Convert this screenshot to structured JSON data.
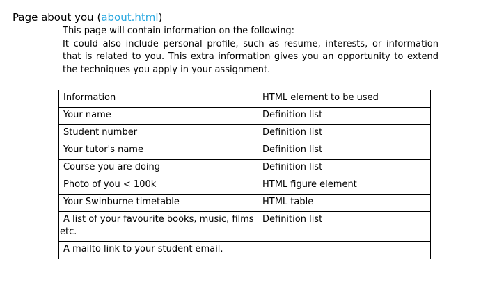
{
  "heading": {
    "label": "Page about you",
    "open_paren": " (",
    "link": "about.html",
    "close_paren": ")"
  },
  "intro": {
    "line1": "This page will contain information on the following:",
    "paragraph": "It could also include personal profile, such as resume, interests, or information that is related to you. This extra information gives you an opportunity to extend the techniques you apply in your assignment."
  },
  "table": {
    "headers": [
      "Information",
      "HTML element to be used"
    ],
    "rows": [
      [
        "Your name",
        "Definition list"
      ],
      [
        "Student number",
        "Definition list"
      ],
      [
        "Your tutor's name",
        "Definition list"
      ],
      [
        "Course you are doing",
        "Definition list"
      ],
      [
        "Photo of you < 100k",
        "HTML figure element"
      ],
      [
        "Your Swinburne timetable",
        "HTML table"
      ],
      [
        "A list of your favourite books, music, films etc.",
        "Definition list"
      ],
      [
        "A mailto link to your student email.",
        ""
      ]
    ]
  }
}
